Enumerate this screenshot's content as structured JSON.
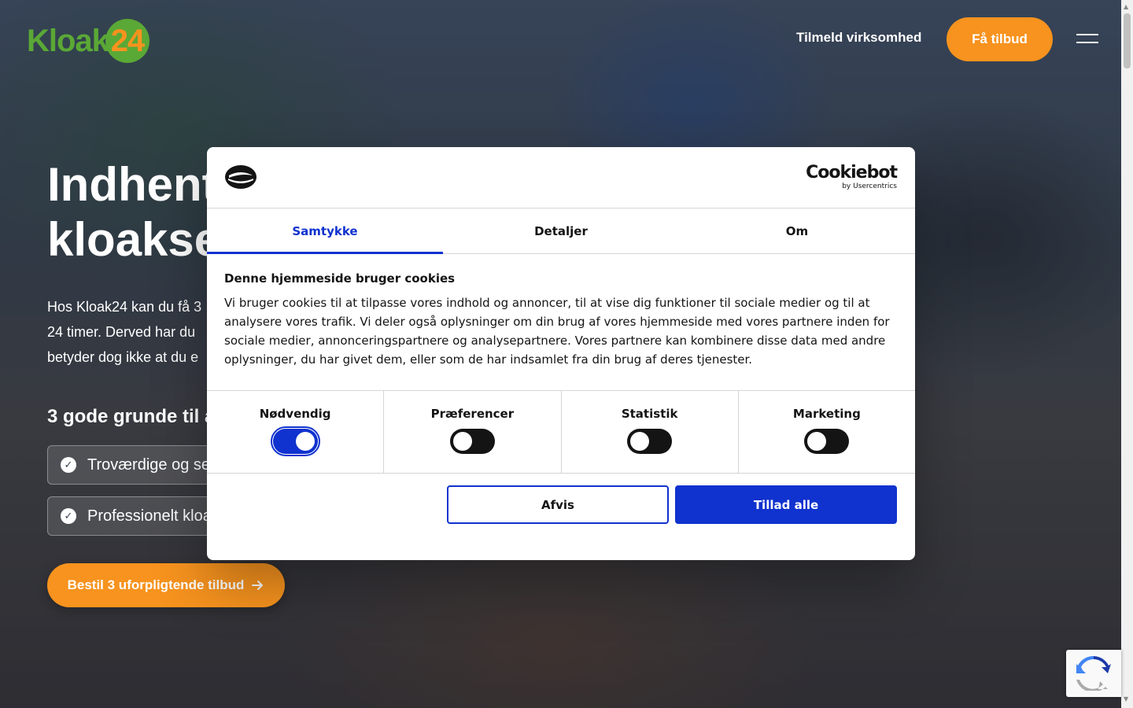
{
  "header": {
    "logo_text": "Kloak",
    "logo_number": "24",
    "nav_link": "Tilmeld virksomhed",
    "cta_label": "Få tilbud",
    "menu_icon": "hamburger-icon"
  },
  "hero": {
    "headline_line1": "Indhent",
    "headline_line2": "kloakse",
    "intro_line1": "Hos Kloak24 kan du få 3",
    "intro_line2": "24 timer. Derved har du",
    "intro_line3": "betyder dog ikke at du e",
    "reasons_title": "3 gode grunde til at",
    "reasons": [
      {
        "text": "Troværdige og se"
      },
      {
        "text": "Professionelt kloa"
      }
    ],
    "cta_label": "Bestil 3 uforpligtende tilbud",
    "cta_icon": "arrow-right-icon"
  },
  "cookie_dialog": {
    "brand_name": "Cookiebot",
    "brand_by": "by Usercentrics",
    "tabs": [
      {
        "label": "Samtykke",
        "active": true
      },
      {
        "label": "Detaljer",
        "active": false
      },
      {
        "label": "Om",
        "active": false
      }
    ],
    "title": "Denne hjemmeside bruger cookies",
    "body": "Vi bruger cookies til at tilpasse vores indhold og annoncer, til at vise dig funktioner til sociale medier og til at analysere vores trafik. Vi deler også oplysninger om din brug af vores hjemmeside med vores partnere inden for sociale medier, annonceringspartnere og analysepartnere. Vores partnere kan kombinere disse data med andre oplysninger, du har givet dem, eller som de har indsamlet fra din brug af deres tjenester.",
    "toggles": [
      {
        "label": "Nødvendig",
        "on": true
      },
      {
        "label": "Præferencer",
        "on": false
      },
      {
        "label": "Statistik",
        "on": false
      },
      {
        "label": "Marketing",
        "on": false
      }
    ],
    "deny_label": "Afvis",
    "allow_label": "Tillad alle"
  },
  "colors": {
    "accent_orange": "#f7931e",
    "logo_green": "#5aa836",
    "cookiebot_blue": "#1032cf"
  }
}
